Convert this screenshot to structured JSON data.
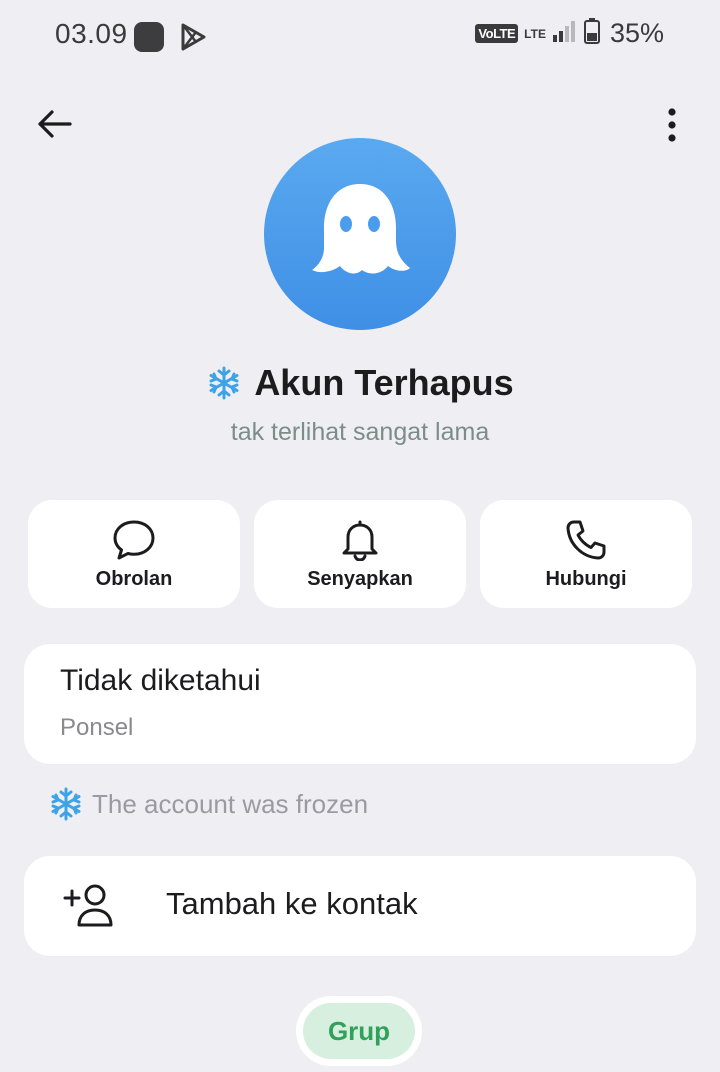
{
  "status_bar": {
    "time": "03.09",
    "volte": "VoLTE",
    "lte": "LTE",
    "battery": "35%"
  },
  "header": {
    "back_icon": "arrow-left-icon",
    "more_icon": "more-vertical-icon"
  },
  "profile": {
    "avatar_icon": "ghost-icon",
    "badge_icon": "snowflake-icon",
    "name": "Akun Terhapus",
    "last_seen": "tak terlihat sangat lama"
  },
  "actions": [
    {
      "icon": "chat-bubble-icon",
      "label": "Obrolan"
    },
    {
      "icon": "bell-icon",
      "label": "Senyapkan"
    },
    {
      "icon": "phone-icon",
      "label": "Hubungi"
    }
  ],
  "phone": {
    "value": "Tidak diketahui",
    "label": "Ponsel"
  },
  "frozen_notice": {
    "icon": "snowflake-icon",
    "text": "The account was frozen"
  },
  "add_contact": {
    "icon": "add-user-icon",
    "label": "Tambah ke kontak"
  },
  "tabs": {
    "group": "Grup"
  },
  "colors": {
    "background": "#efeff3",
    "avatar": "#4a9cec",
    "group_pill_bg": "#d6efdf",
    "group_pill_text": "#2fa15a",
    "snowflake": "#3da3e6"
  }
}
